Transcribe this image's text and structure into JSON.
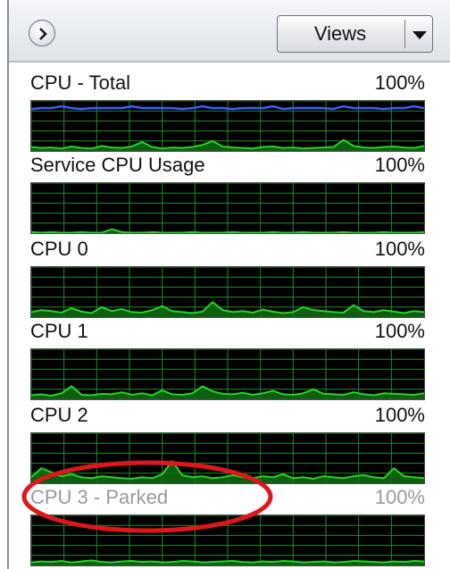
{
  "toolbar": {
    "views_label": "Views",
    "nav_icon": "chevron-right-icon",
    "dropdown_icon": "triangle-down-icon"
  },
  "colors": {
    "graph_background": "#000000",
    "grid": "#1f8a2a",
    "usage_line": "#22d424",
    "usage_fill": "#0f6e12",
    "total_line": "#3a5cff",
    "annotation": "#e0161a"
  },
  "cpus": [
    {
      "label": "CPU - Total",
      "percent": "100%",
      "parked": false,
      "show_total_line": true,
      "usage": [
        8,
        6,
        7,
        5,
        9,
        6,
        5,
        10,
        7,
        6,
        9,
        18,
        8,
        5,
        7,
        6,
        8,
        12,
        20,
        9,
        7,
        6,
        5,
        8,
        9,
        6,
        7,
        5,
        6,
        7,
        8,
        22,
        10,
        7,
        6,
        8,
        9,
        7,
        6,
        10
      ]
    },
    {
      "label": "Service CPU Usage",
      "percent": "100%",
      "parked": false,
      "show_total_line": false,
      "usage": [
        2,
        1,
        2,
        1,
        1,
        2,
        1,
        1,
        8,
        2,
        1,
        1,
        2,
        1,
        1,
        1,
        2,
        1,
        1,
        1,
        2,
        1,
        1,
        1,
        2,
        1,
        1,
        2,
        1,
        1,
        1,
        2,
        1,
        1,
        1,
        2,
        1,
        1,
        1,
        2
      ]
    },
    {
      "label": "CPU 0",
      "percent": "100%",
      "parked": false,
      "show_total_line": false,
      "usage": [
        10,
        14,
        12,
        9,
        18,
        11,
        8,
        20,
        12,
        16,
        10,
        9,
        14,
        22,
        12,
        10,
        8,
        11,
        30,
        14,
        10,
        12,
        9,
        15,
        11,
        8,
        10,
        20,
        14,
        12,
        10,
        9,
        24,
        12,
        10,
        14,
        11,
        8,
        12,
        10
      ]
    },
    {
      "label": "CPU 1",
      "percent": "100%",
      "parked": false,
      "show_total_line": false,
      "usage": [
        8,
        10,
        7,
        12,
        26,
        9,
        8,
        11,
        10,
        14,
        9,
        12,
        8,
        18,
        10,
        9,
        12,
        26,
        16,
        11,
        10,
        13,
        9,
        12,
        17,
        10,
        9,
        12,
        20,
        11,
        10,
        9,
        14,
        10,
        8,
        12,
        11,
        10,
        9,
        12
      ]
    },
    {
      "label": "CPU 2",
      "percent": "100%",
      "parked": false,
      "show_total_line": false,
      "usage": [
        12,
        30,
        22,
        14,
        18,
        12,
        10,
        14,
        12,
        10,
        9,
        12,
        10,
        18,
        44,
        16,
        12,
        14,
        10,
        12,
        16,
        12,
        10,
        14,
        12,
        18,
        10,
        12,
        9,
        14,
        12,
        10,
        14,
        16,
        12,
        10,
        30,
        14,
        12,
        10
      ]
    },
    {
      "label": "CPU 3 - Parked",
      "percent": "100%",
      "parked": true,
      "show_total_line": false,
      "usage": [
        6,
        8,
        7,
        9,
        6,
        8,
        10,
        7,
        6,
        8,
        9,
        7,
        8,
        6,
        7,
        9,
        8,
        6,
        7,
        8,
        9,
        7,
        6,
        8,
        7,
        9,
        8,
        6,
        7,
        8,
        6,
        7,
        9,
        8,
        7,
        6,
        8,
        7,
        9,
        8
      ]
    }
  ]
}
